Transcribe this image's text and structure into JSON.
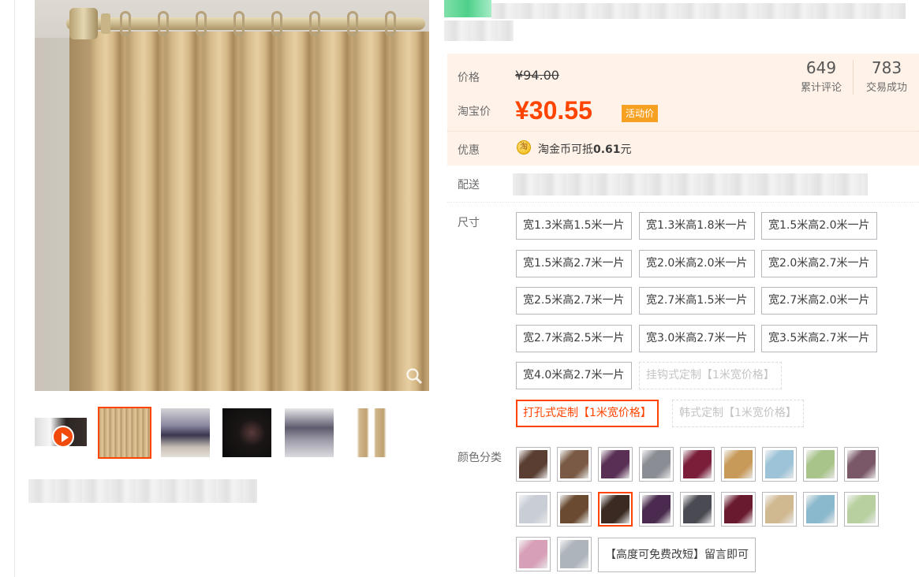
{
  "gallery": {
    "thumbnails": [
      "video",
      "curtain-beige",
      "room-purple",
      "dark-window",
      "bedroom-grey",
      "curtain-pair"
    ],
    "selected_index": 1
  },
  "price": {
    "list_label": "价格",
    "list_price": "¥94.00",
    "sale_label": "淘宝价",
    "sale_price": "¥30.55",
    "sale_tag": "活动价",
    "stats": [
      {
        "num": "649",
        "caption": "累计评论"
      },
      {
        "num": "783",
        "caption": "交易成功"
      }
    ]
  },
  "promo": {
    "label": "优惠",
    "icon": "淘",
    "text_prefix": "淘金币可抵",
    "amount": "0.61",
    "text_suffix": "元"
  },
  "shipping": {
    "label": "配送"
  },
  "size": {
    "label": "尺寸",
    "options": [
      "宽1.3米高1.5米一片",
      "宽1.3米高1.8米一片",
      "宽1.5米高2.0米一片",
      "宽1.5米高2.7米一片",
      "宽2.0米高2.0米一片",
      "宽2.0米高2.7米一片",
      "宽2.5米高2.7米一片",
      "宽2.7米高1.5米一片",
      "宽2.7米高2.0米一片",
      "宽2.7米高2.5米一片",
      "宽3.0米高2.7米一片",
      "宽3.5米高2.7米一片",
      "宽4.0米高2.7米一片",
      "挂钩式定制【1米宽价格】",
      "打孔式定制【1米宽价格】",
      "韩式定制【1米宽价格】"
    ],
    "disabled": [
      13,
      15
    ],
    "selected": 14
  },
  "color": {
    "label": "颜色分类",
    "swatch_colors": [
      "#5a3e32",
      "#7a5a44",
      "#5a2f55",
      "#8a8d94",
      "#7a1e3a",
      "#c89a5a",
      "#9cc3d8",
      "#a9c48a",
      "#7a5868",
      "#c9ced6",
      "#6a4a30",
      "#3a2a22",
      "#4a2a4e",
      "#4a4a52",
      "#6a1a2e",
      "#d0b890",
      "#8ab8cc",
      "#b8d0a0",
      "#d8a0b8",
      "#aeb4bc"
    ],
    "selected": 11,
    "text_option": "【高度可免费改短】留言即可"
  }
}
